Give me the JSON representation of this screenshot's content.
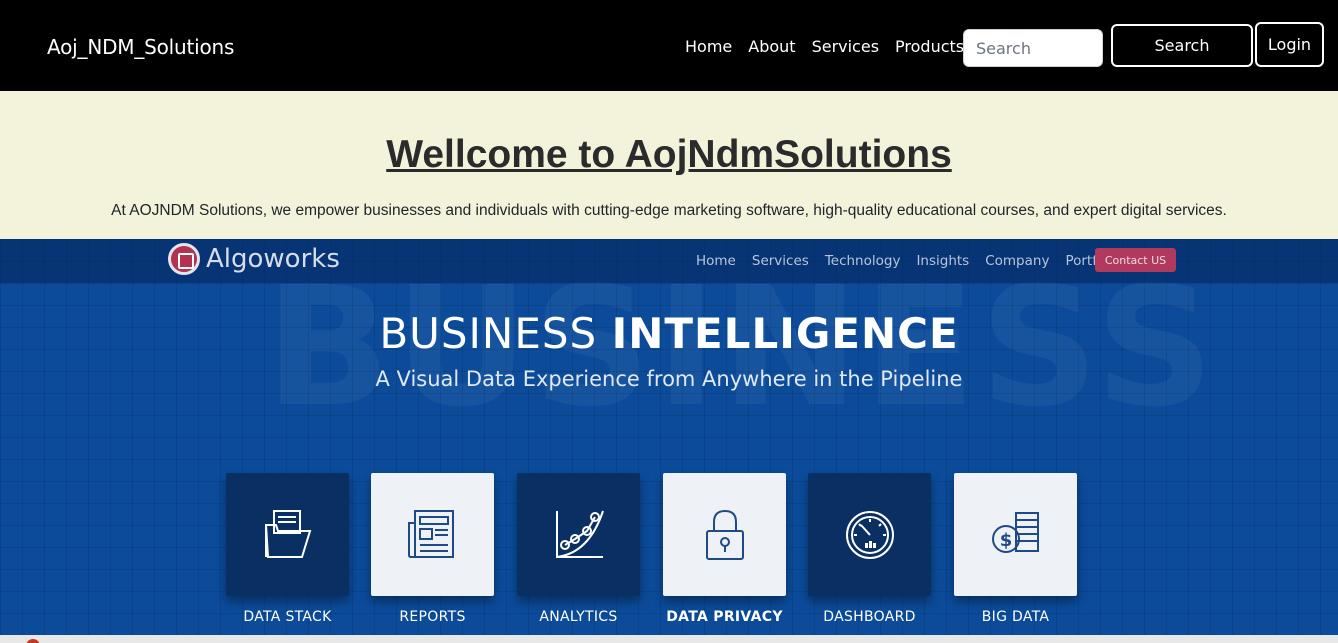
{
  "navbar": {
    "brand": "Aoj_NDM_Solutions",
    "links": [
      "Home",
      "About",
      "Services",
      "Products"
    ],
    "search_placeholder": "Search",
    "search_button": "Search",
    "login_button": "Login"
  },
  "hero": {
    "title": "Wellcome to AojNdmSolutions",
    "subtitle": "At AOJNDM Solutions, we empower businesses and individuals with cutting-edge marketing software, high-quality educational courses, and expert digital services."
  },
  "banner": {
    "logo_text": "Algoworks",
    "nav": [
      "Home",
      "Services",
      "Technology",
      "Insights",
      "Company",
      "Portfolio"
    ],
    "contact_button": "Contact US",
    "background_word": "BUSINESS",
    "title_light": "BUSINESS ",
    "title_bold": "INTELLIGENCE",
    "subtitle": "A Visual Data Experience from Anywhere in the Pipeline",
    "tiles": [
      {
        "label": "DATA STACK",
        "icon": "folder-documents-icon",
        "style": "dark"
      },
      {
        "label": "REPORTS",
        "icon": "newspaper-report-icon",
        "style": "light"
      },
      {
        "label": "ANALYTICS",
        "icon": "line-graph-icon",
        "style": "dark"
      },
      {
        "label": "DATA PRIVACY",
        "icon": "padlock-icon",
        "style": "light"
      },
      {
        "label": "DASHBOARD",
        "icon": "gauge-icon",
        "style": "dark"
      },
      {
        "label": "BIG DATA",
        "icon": "coin-database-icon",
        "style": "light"
      }
    ]
  },
  "colors": {
    "navbar_bg": "#000000",
    "hero_bg": "#f3f3dc",
    "banner_blue": "#0b4b9a",
    "tile_dark": "#0a2f63",
    "tile_light": "#eef1f6",
    "contact_accent": "#b03a5e"
  }
}
